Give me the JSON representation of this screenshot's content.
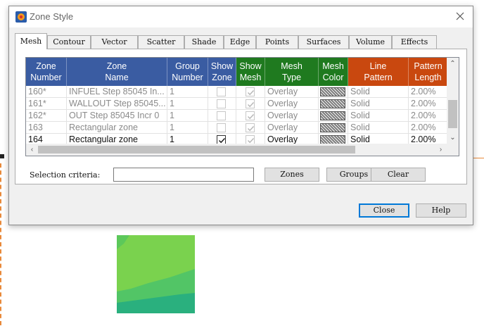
{
  "window": {
    "title": "Zone Style"
  },
  "tabs": [
    "Mesh",
    "Contour",
    "Vector",
    "Scatter",
    "Shade",
    "Edge",
    "Points",
    "Surfaces",
    "Volume",
    "Effects"
  ],
  "active_tab": "Mesh",
  "columns": [
    {
      "line1": "Zone",
      "line2": "Number",
      "group": "blue"
    },
    {
      "line1": "Zone",
      "line2": "Name",
      "group": "blue"
    },
    {
      "line1": "Group",
      "line2": "Number",
      "group": "blue"
    },
    {
      "line1": "Show",
      "line2": "Zone",
      "group": "blue"
    },
    {
      "line1": "Show",
      "line2": "Mesh",
      "group": "green"
    },
    {
      "line1": "Mesh",
      "line2": "Type",
      "group": "green"
    },
    {
      "line1": "Mesh",
      "line2": "Color",
      "group": "green"
    },
    {
      "line1": "Line",
      "line2": "Pattern",
      "group": "orange"
    },
    {
      "line1": "Pattern",
      "line2": "Length",
      "group": "orange"
    }
  ],
  "rows": [
    {
      "number": "160*",
      "name": "INFUEL Step 85045 In...",
      "group": "1",
      "show_zone": false,
      "show_mesh": true,
      "mesh_type": "Overlay",
      "line_pattern": "Solid",
      "pattern_length": "2.00%",
      "active": false
    },
    {
      "number": "161*",
      "name": "WALLOUT Step 85045...",
      "group": "1",
      "show_zone": false,
      "show_mesh": true,
      "mesh_type": "Overlay",
      "line_pattern": "Solid",
      "pattern_length": "2.00%",
      "active": false
    },
    {
      "number": "162*",
      "name": "OUT Step 85045 Incr 0",
      "group": "1",
      "show_zone": false,
      "show_mesh": true,
      "mesh_type": "Overlay",
      "line_pattern": "Solid",
      "pattern_length": "2.00%",
      "active": false
    },
    {
      "number": "163",
      "name": "Rectangular zone",
      "group": "1",
      "show_zone": false,
      "show_mesh": true,
      "mesh_type": "Overlay",
      "line_pattern": "Solid",
      "pattern_length": "2.00%",
      "active": false
    },
    {
      "number": "164",
      "name": "Rectangular zone",
      "group": "1",
      "show_zone": true,
      "show_mesh": true,
      "mesh_type": "Overlay",
      "line_pattern": "Solid",
      "pattern_length": "2.00%",
      "active": true
    }
  ],
  "selection": {
    "label": "Selection criteria:",
    "value": ""
  },
  "buttons": {
    "zones": "Zones",
    "groups": "Groups",
    "clear": "Clear",
    "close": "Close",
    "help": "Help"
  },
  "colors": {
    "header_blue": "#3a5ca2",
    "header_green": "#1f7a1f",
    "header_orange": "#c9480f"
  },
  "icons": {
    "app": "app-logo-icon",
    "close": "close-icon",
    "scroll_up": "chevron-up-icon",
    "scroll_down": "chevron-down-icon",
    "scroll_left": "chevron-left-icon",
    "scroll_right": "chevron-right-icon"
  }
}
